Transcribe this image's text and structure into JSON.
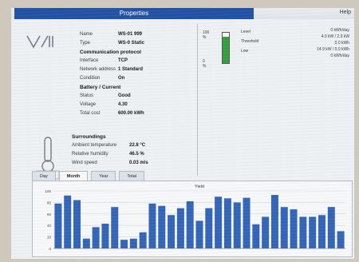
{
  "window": {
    "title": "Properties",
    "help": "Help"
  },
  "device": {
    "properties": [
      {
        "key": "Name",
        "value": "WS-01 999"
      },
      {
        "key": "Type",
        "value": "WS-0 Static"
      }
    ],
    "communication_section": "Communication protocol",
    "comm_rows": [
      {
        "key": "Interface",
        "value": "TCP"
      },
      {
        "key": "Network address",
        "value": "1 Standard"
      },
      {
        "key": "Condition",
        "value": "On"
      }
    ],
    "battery_section": "Battery / Current",
    "battery_rows": [
      {
        "key": "Status",
        "value": "Good"
      },
      {
        "key": "Voltage",
        "value": "4.30"
      },
      {
        "key": "Total cost",
        "value": "600.00 kWh"
      }
    ]
  },
  "environment": {
    "section": "Surroundings",
    "rows": [
      {
        "key": "Ambient temperature",
        "value": "22.8 °C"
      },
      {
        "key": "Relative humidity",
        "value": "46.5 %"
      },
      {
        "key": "Wind speed",
        "value": "0.03 m/s"
      }
    ]
  },
  "tank": {
    "level": 0.86,
    "fill_color": "#2f9e3a",
    "tick_top": "100 %",
    "tick_bottom": "0 %",
    "legend": [
      "Level",
      "Threshold",
      "Low"
    ],
    "stats": [
      "0 kWh/day",
      "4.0 kW / 2.9 kW",
      "0.0 kWh",
      "14.9 kW / 0.0 kWh",
      "0 kWh/day"
    ]
  },
  "tabs": [
    {
      "label": "Day",
      "active": false
    },
    {
      "label": "Month",
      "active": true
    },
    {
      "label": "Year",
      "active": false
    },
    {
      "label": "Total",
      "active": false
    }
  ],
  "chart_data": {
    "type": "bar",
    "title": "Yield",
    "xlabel": "",
    "ylabel": "",
    "bar_color": "#2f62b8",
    "ylim": [
      0,
      100
    ],
    "categories": [
      "1",
      "2",
      "3",
      "4",
      "5",
      "6",
      "7",
      "8",
      "9",
      "10",
      "11",
      "12",
      "13",
      "14",
      "15",
      "16",
      "17",
      "18",
      "19",
      "20",
      "21",
      "22",
      "23",
      "24",
      "25",
      "26",
      "27",
      "28",
      "29",
      "30",
      "31"
    ],
    "values": [
      78,
      92,
      84,
      17,
      37,
      43,
      72,
      15,
      17,
      28,
      78,
      74,
      58,
      70,
      82,
      48,
      70,
      90,
      87,
      80,
      88,
      42,
      55,
      93,
      72,
      68,
      55,
      55,
      58,
      72,
      30
    ],
    "yticks": [
      "100",
      "80",
      "60",
      "40",
      "20",
      "0"
    ]
  }
}
